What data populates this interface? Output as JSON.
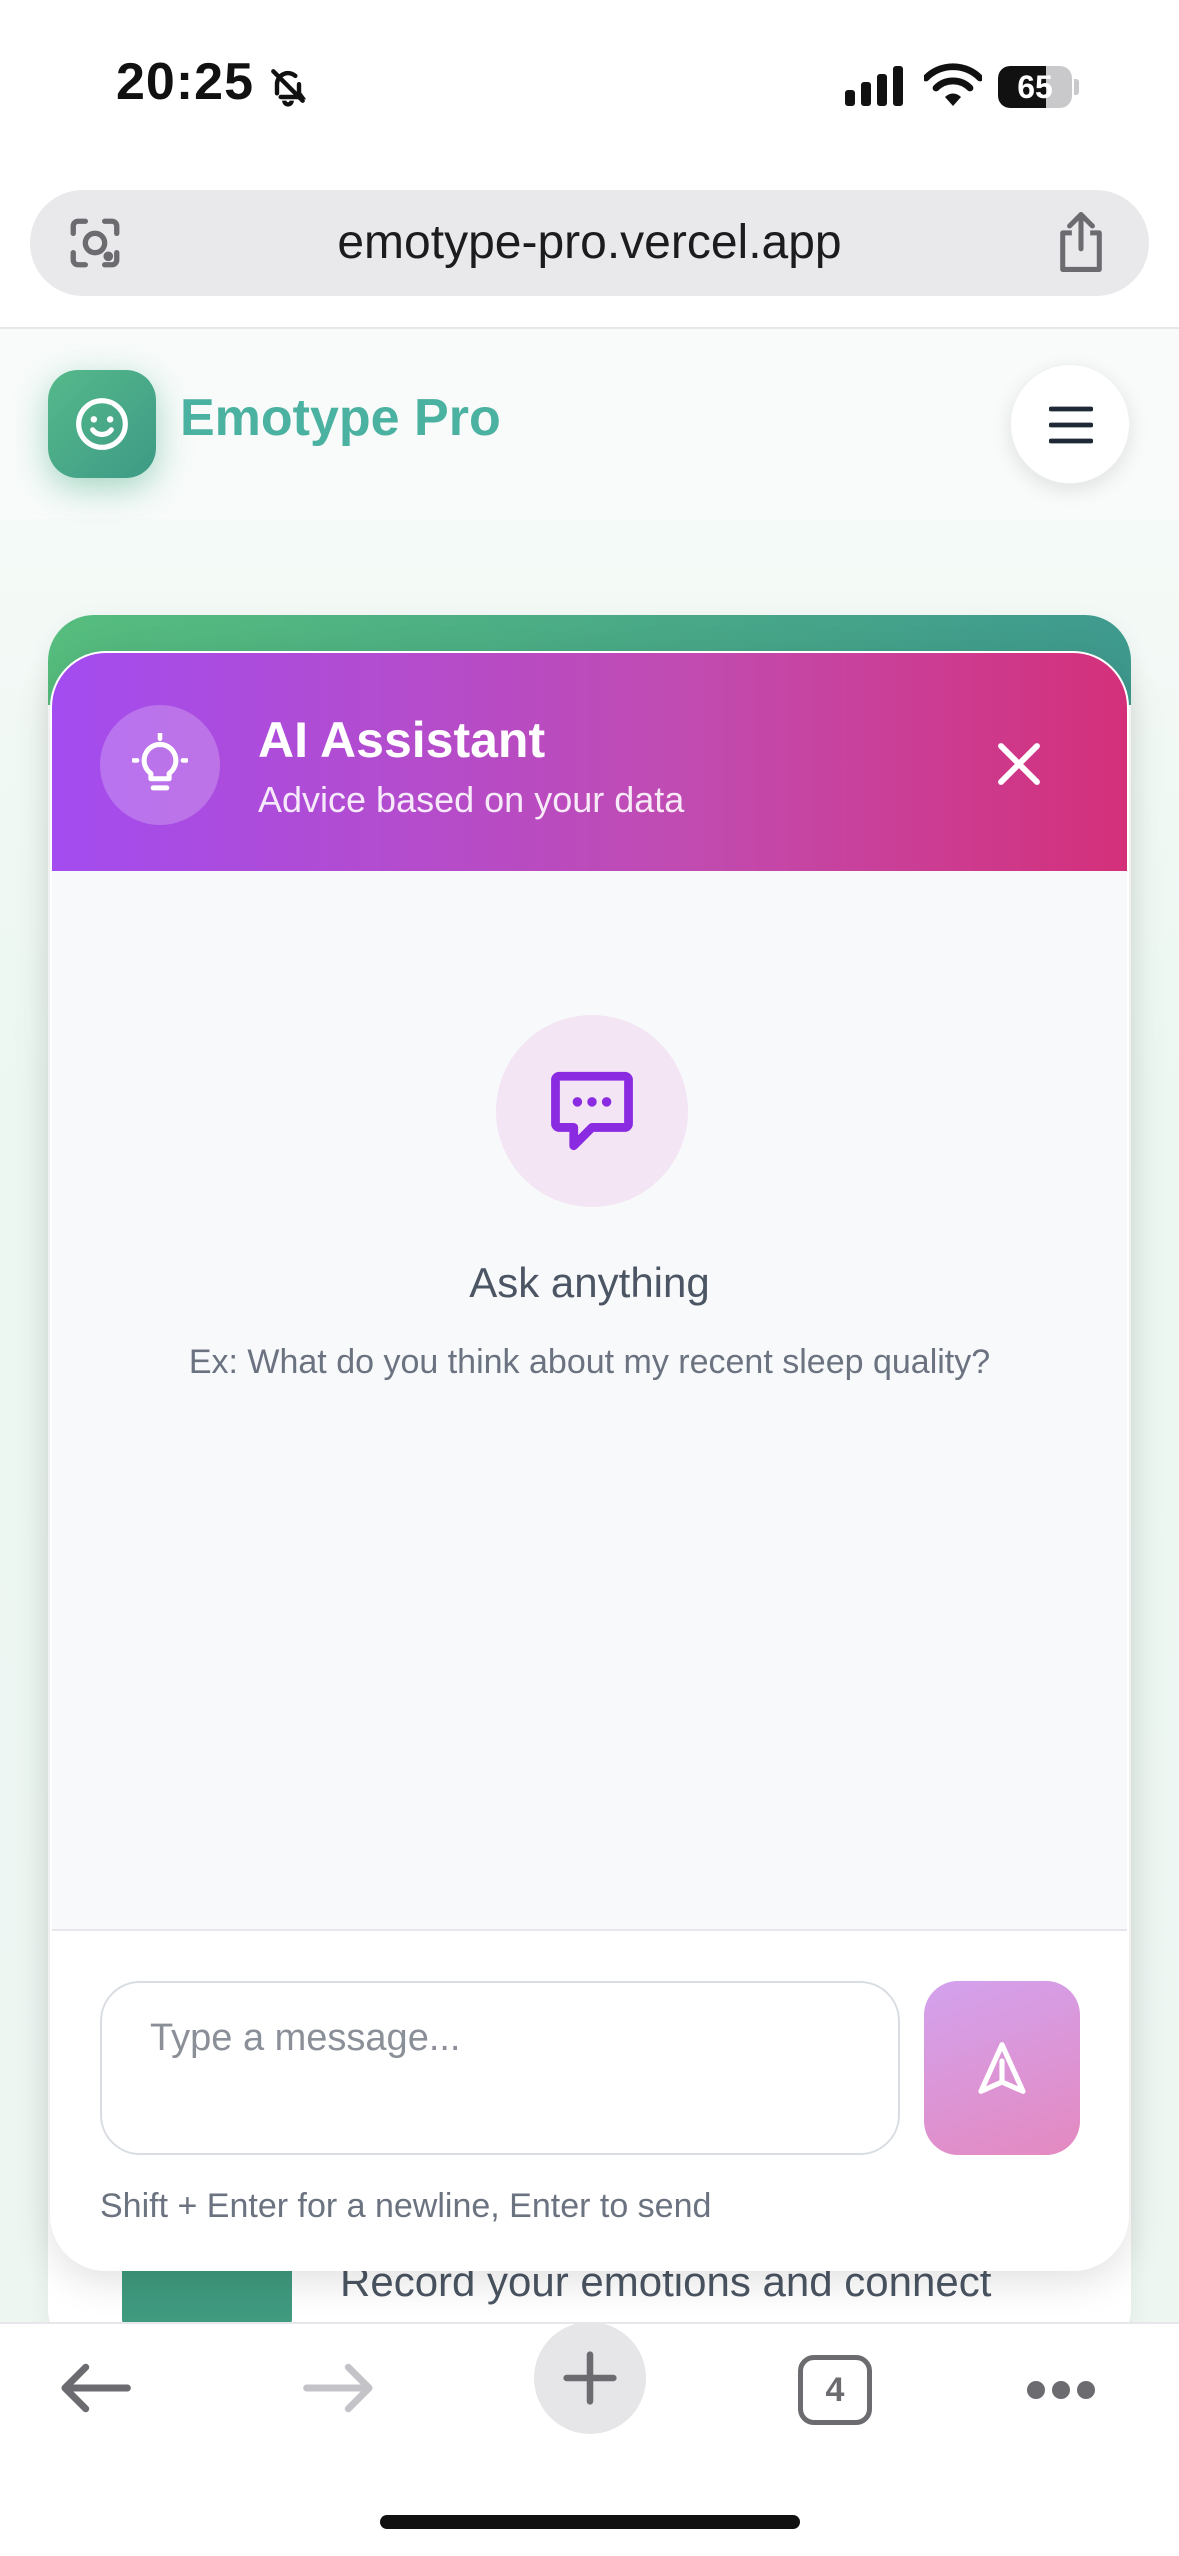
{
  "status_bar": {
    "time": "20:25",
    "battery": "65",
    "battery_level_percent": 65
  },
  "browser": {
    "url": "emotype-pro.vercel.app",
    "tab_count": "4"
  },
  "app": {
    "title": "Emotype Pro"
  },
  "chat": {
    "title": "AI Assistant",
    "subtitle": "Advice based on your data",
    "empty_title": "Ask anything",
    "empty_hint": "Ex: What do you think about my recent sleep quality?",
    "input_placeholder": "Type a message...",
    "input_hint": "Shift + Enter for a newline, Enter to send"
  },
  "background_page": {
    "record_text": "Record your emotions and connect"
  },
  "colors": {
    "brand_green": "#4bb1a0",
    "chat_gradient_start": "#a34cf0",
    "chat_gradient_end": "#d4307a"
  },
  "icons": [
    "bell-off-icon",
    "signal-icon",
    "wifi-icon",
    "battery-icon",
    "lens-icon",
    "share-icon",
    "smile-icon",
    "menu-icon",
    "lightbulb-icon",
    "close-icon",
    "chat-bubble-icon",
    "send-icon",
    "back-arrow-icon",
    "forward-arrow-icon",
    "plus-icon",
    "more-icon"
  ]
}
